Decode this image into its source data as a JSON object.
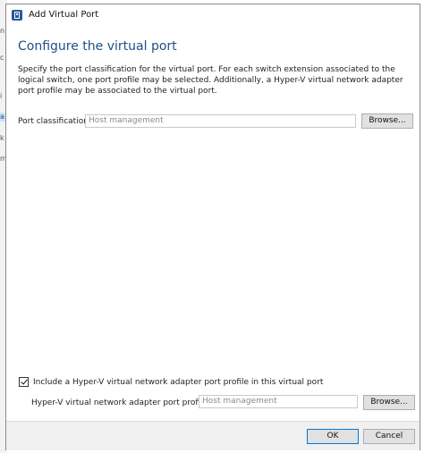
{
  "background_app": {
    "glyphs": [
      "n",
      "",
      "c",
      "i",
      "",
      "a",
      "k",
      "",
      "m"
    ]
  },
  "dialog": {
    "title": "Add Virtual Port",
    "heading": "Configure the virtual port",
    "description": "Specify the port classification for the virtual port. For each switch extension associated to the logical switch, one port profile may be selected. Additionally, a Hyper-V virtual network adapter port profile may be associated to the virtual port.",
    "port_classification": {
      "label": "Port classification:",
      "value": "Host management",
      "browse_label": "Browse..."
    },
    "include_profile": {
      "checked": true,
      "label": "Include a Hyper-V virtual network adapter port profile in this virtual port"
    },
    "adapter_profile": {
      "label": "Hyper-V virtual network adapter port profile:",
      "value": "Host management",
      "browse_label": "Browse..."
    },
    "buttons": {
      "ok_label": "OK",
      "cancel_label": "Cancel"
    }
  },
  "colors": {
    "heading": "#1f4e8a",
    "accent": "#0078d7",
    "footer_bg": "#f0f0f0"
  }
}
